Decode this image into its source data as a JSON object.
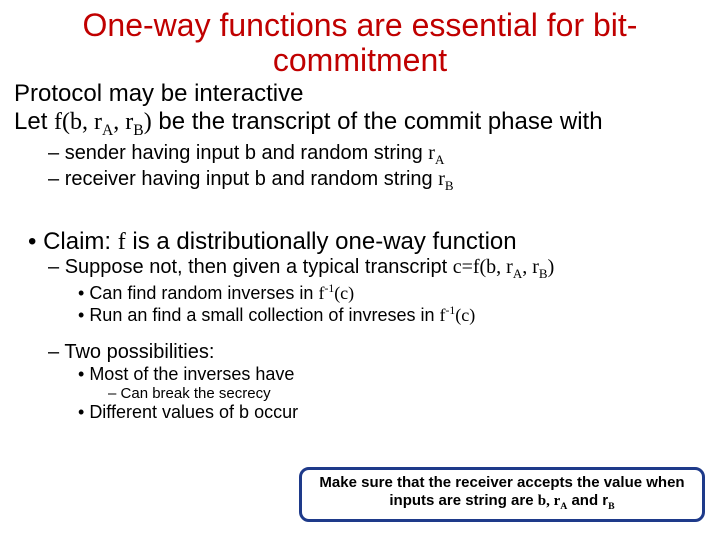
{
  "title": "One-way functions are essential for bit-commitment",
  "protocol": "Protocol may be interactive",
  "let_a": "Let ",
  "let_fn": "f(b, r",
  "let_sA": "A",
  "let_mid1": ", r",
  "let_sB": "B",
  "let_close": ")",
  "let_b": " be the transcript of the commit phase with",
  "sender_a": "sender having input b and random string  ",
  "sender_r": "r",
  "sender_sA": "A",
  "receiver_a": "receiver having input b and random string  ",
  "receiver_r": "r",
  "receiver_sB": "B",
  "claim_a": "Claim: ",
  "claim_f": "f",
  "claim_b": " is a distributionally one-way function",
  "suppose_a": "Suppose not, then given a typical transcript ",
  "suppose_c": "c=f(b, r",
  "suppose_sA": "A",
  "suppose_mid": ", r",
  "suppose_sB": "B",
  "suppose_close": ")",
  "canfind_a": "Can find random inverses in ",
  "canfind_f": "f",
  "canfind_exp": "-1",
  "canfind_arg": "(c)",
  "run_a": "Run an find a small collection of invreses in ",
  "run_f": "f",
  "run_exp": "-1",
  "run_arg": "(c)",
  "twoposs": "Two possibilities:",
  "most": "Most of the inverses have ",
  "secrecy": "Can break the secrecy",
  "diffb": "Different values of b occur",
  "call_a": "Make sure that the receiver accepts the value when inputs are string are ",
  "call_b": "b, r",
  "call_sA": "A",
  "call_and": " and r",
  "call_sB": "B"
}
